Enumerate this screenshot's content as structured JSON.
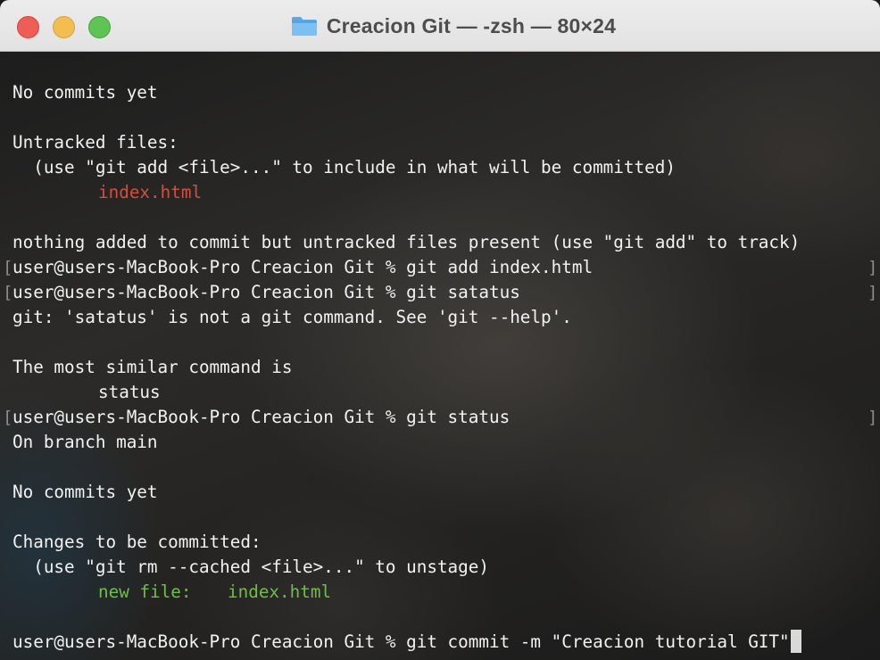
{
  "window": {
    "title": "Creacion Git — -zsh — 80×24",
    "folder_icon": "folder-icon",
    "controls": [
      "close",
      "minimize",
      "zoom"
    ],
    "colors": {
      "close": "#ee5e55",
      "minimize": "#f4bd4f",
      "zoom": "#5fc453",
      "untracked_file": "#d2503f",
      "staged_file": "#6cc046"
    }
  },
  "terminal": {
    "lines": {
      "l1": "No commits yet",
      "l3": "Untracked files:",
      "l4": "  (use \"git add <file>...\" to include in what will be committed)",
      "l5_file": "index.html",
      "l7": "nothing added to commit but untracked files present (use \"git add\" to track)",
      "l8": "user@users-MacBook-Pro Creacion Git % git add index.html",
      "l9": "user@users-MacBook-Pro Creacion Git % git satatus",
      "l10": "git: 'satatus' is not a git command. See 'git --help'.",
      "l12": "The most similar command is",
      "l13": "status",
      "l14": "user@users-MacBook-Pro Creacion Git % git status",
      "l15": "On branch main",
      "l17": "No commits yet",
      "l19": "Changes to be committed:",
      "l20": "  (use \"git rm --cached <file>...\" to unstage)",
      "l21_label": "new file:",
      "l21_file": "index.html",
      "l23": "user@users-MacBook-Pro Creacion Git % git commit -m \"Creacion tutorial GIT\""
    },
    "bracket_left": "[",
    "bracket_right": "]"
  }
}
